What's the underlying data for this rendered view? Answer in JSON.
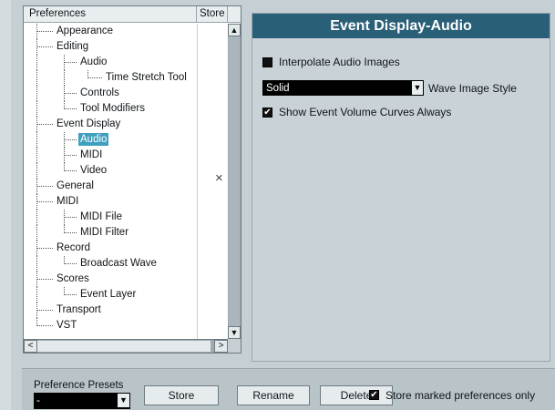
{
  "tree": {
    "header_preferences": "Preferences",
    "header_store": "Store",
    "items": [
      {
        "label": "Appearance"
      },
      {
        "label": "Editing"
      },
      {
        "label": "Audio"
      },
      {
        "label": "Time Stretch Tool"
      },
      {
        "label": "Controls"
      },
      {
        "label": "Tool Modifiers"
      },
      {
        "label": "Event Display"
      },
      {
        "label": "Audio"
      },
      {
        "label": "MIDI"
      },
      {
        "label": "Video"
      },
      {
        "label": "General"
      },
      {
        "label": "MIDI"
      },
      {
        "label": "MIDI File"
      },
      {
        "label": "MIDI Filter"
      },
      {
        "label": "Record"
      },
      {
        "label": "Broadcast Wave"
      },
      {
        "label": "Scores"
      },
      {
        "label": "Event Layer"
      },
      {
        "label": "Transport"
      },
      {
        "label": "VST"
      }
    ],
    "store_mark": "×",
    "scroll_up": "▲",
    "scroll_down": "▼",
    "scroll_left": "<",
    "scroll_right": ">"
  },
  "panel": {
    "title": "Event Display-Audio",
    "interpolate_label": "Interpolate Audio Images",
    "wave_style_value": "Solid",
    "wave_style_label": "Wave Image Style",
    "show_curves_label": "Show Event Volume Curves Always",
    "check_mark": "✔",
    "dropdown_arrow": "▼"
  },
  "bottom": {
    "presets_label": "Preference Presets",
    "presets_value": "-",
    "store_label": "Store",
    "rename_label": "Rename",
    "delete_label": "Delete",
    "store_marked_label": "Store marked preferences only"
  },
  "colors": {
    "title_bg": "#2a5f78",
    "selection": "#3e9fbf"
  }
}
